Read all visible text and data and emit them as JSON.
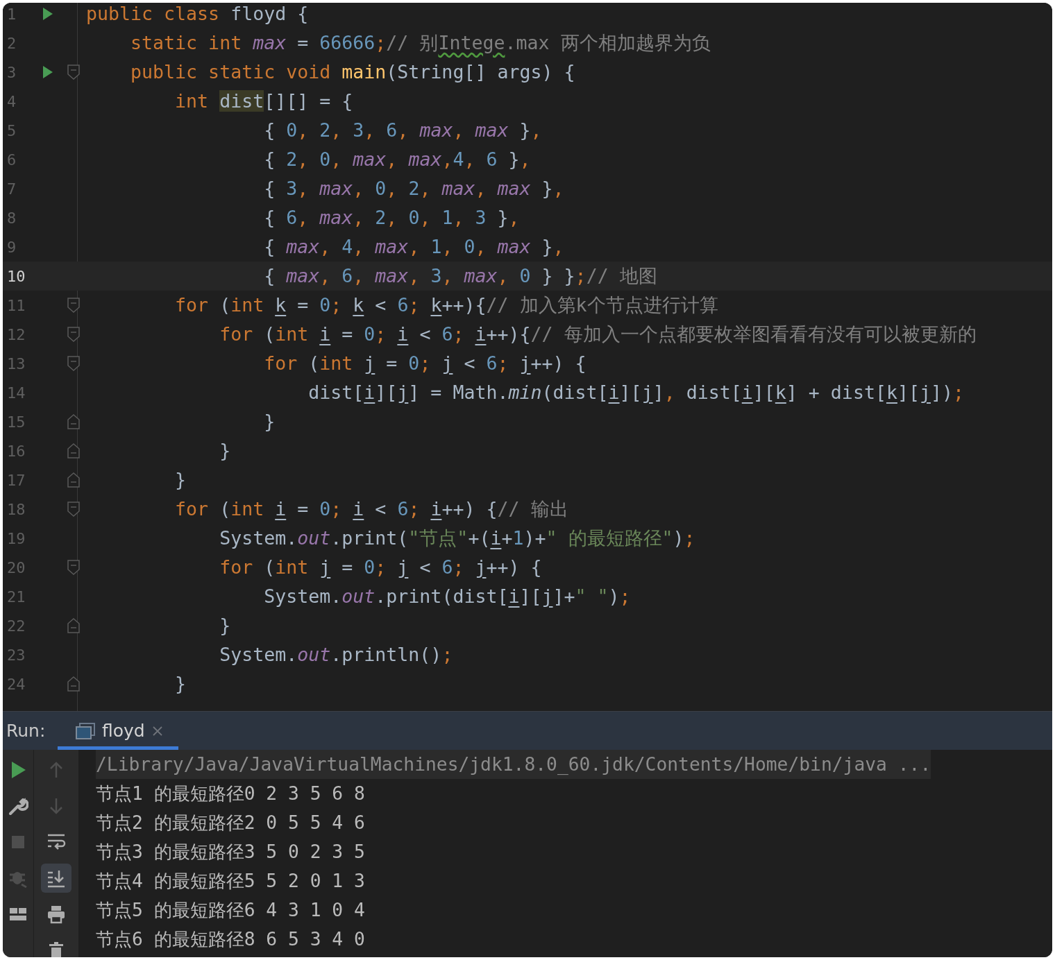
{
  "editor": {
    "lines": [
      {
        "number": "1",
        "run": true,
        "tokens": [
          {
            "kind": "kw",
            "text": "public class "
          },
          {
            "kind": "plain",
            "text": "floyd {"
          }
        ]
      },
      {
        "number": "2",
        "tokens": [
          {
            "kind": "kw",
            "text": "    static int "
          },
          {
            "kind": "field",
            "text": "max"
          },
          {
            "kind": "plain",
            "text": " = "
          },
          {
            "kind": "num",
            "text": "66666"
          },
          {
            "kind": "kw",
            "text": ";"
          },
          {
            "kind": "cmt",
            "text": "// 别"
          },
          {
            "kind": "typo",
            "text": "Intege"
          },
          {
            "kind": "cmt",
            "text": ".max 两个相加越界为负"
          }
        ]
      },
      {
        "number": "3",
        "run": true,
        "fold_open": true,
        "tokens": [
          {
            "kind": "kw",
            "text": "    public static void "
          },
          {
            "kind": "method",
            "text": "main"
          },
          {
            "kind": "plain",
            "text": "(String[] args) {"
          }
        ]
      },
      {
        "number": "4",
        "tokens": [
          {
            "kind": "kw",
            "text": "        int "
          },
          {
            "kind": "hl",
            "text": "dist"
          },
          {
            "kind": "plain",
            "text": "[][] = {"
          }
        ]
      },
      {
        "number": "5",
        "tokens": [
          {
            "kind": "plain",
            "text": "                { "
          },
          {
            "kind": "num",
            "text": "0"
          },
          {
            "kind": "kw",
            "text": ", "
          },
          {
            "kind": "num",
            "text": "2"
          },
          {
            "kind": "kw",
            "text": ", "
          },
          {
            "kind": "num",
            "text": "3"
          },
          {
            "kind": "kw",
            "text": ", "
          },
          {
            "kind": "num",
            "text": "6"
          },
          {
            "kind": "kw",
            "text": ", "
          },
          {
            "kind": "field",
            "text": "max"
          },
          {
            "kind": "kw",
            "text": ", "
          },
          {
            "kind": "field",
            "text": "max"
          },
          {
            "kind": "plain",
            "text": " }"
          },
          {
            "kind": "kw",
            "text": ","
          }
        ]
      },
      {
        "number": "6",
        "tokens": [
          {
            "kind": "plain",
            "text": "                { "
          },
          {
            "kind": "num",
            "text": "2"
          },
          {
            "kind": "kw",
            "text": ", "
          },
          {
            "kind": "num",
            "text": "0"
          },
          {
            "kind": "kw",
            "text": ", "
          },
          {
            "kind": "field",
            "text": "max"
          },
          {
            "kind": "kw",
            "text": ", "
          },
          {
            "kind": "field",
            "text": "max"
          },
          {
            "kind": "kw",
            "text": ","
          },
          {
            "kind": "num",
            "text": "4"
          },
          {
            "kind": "kw",
            "text": ", "
          },
          {
            "kind": "num",
            "text": "6"
          },
          {
            "kind": "plain",
            "text": " }"
          },
          {
            "kind": "kw",
            "text": ","
          }
        ]
      },
      {
        "number": "7",
        "tokens": [
          {
            "kind": "plain",
            "text": "                { "
          },
          {
            "kind": "num",
            "text": "3"
          },
          {
            "kind": "kw",
            "text": ", "
          },
          {
            "kind": "field",
            "text": "max"
          },
          {
            "kind": "kw",
            "text": ", "
          },
          {
            "kind": "num",
            "text": "0"
          },
          {
            "kind": "kw",
            "text": ", "
          },
          {
            "kind": "num",
            "text": "2"
          },
          {
            "kind": "kw",
            "text": ", "
          },
          {
            "kind": "field",
            "text": "max"
          },
          {
            "kind": "kw",
            "text": ", "
          },
          {
            "kind": "field",
            "text": "max"
          },
          {
            "kind": "plain",
            "text": " }"
          },
          {
            "kind": "kw",
            "text": ","
          }
        ]
      },
      {
        "number": "8",
        "tokens": [
          {
            "kind": "plain",
            "text": "                { "
          },
          {
            "kind": "num",
            "text": "6"
          },
          {
            "kind": "kw",
            "text": ", "
          },
          {
            "kind": "field",
            "text": "max"
          },
          {
            "kind": "kw",
            "text": ", "
          },
          {
            "kind": "num",
            "text": "2"
          },
          {
            "kind": "kw",
            "text": ", "
          },
          {
            "kind": "num",
            "text": "0"
          },
          {
            "kind": "kw",
            "text": ", "
          },
          {
            "kind": "num",
            "text": "1"
          },
          {
            "kind": "kw",
            "text": ", "
          },
          {
            "kind": "num",
            "text": "3"
          },
          {
            "kind": "plain",
            "text": " }"
          },
          {
            "kind": "kw",
            "text": ","
          }
        ]
      },
      {
        "number": "9",
        "tokens": [
          {
            "kind": "plain",
            "text": "                { "
          },
          {
            "kind": "field",
            "text": "max"
          },
          {
            "kind": "kw",
            "text": ", "
          },
          {
            "kind": "num",
            "text": "4"
          },
          {
            "kind": "kw",
            "text": ", "
          },
          {
            "kind": "field",
            "text": "max"
          },
          {
            "kind": "kw",
            "text": ", "
          },
          {
            "kind": "num",
            "text": "1"
          },
          {
            "kind": "kw",
            "text": ", "
          },
          {
            "kind": "num",
            "text": "0"
          },
          {
            "kind": "kw",
            "text": ", "
          },
          {
            "kind": "field",
            "text": "max"
          },
          {
            "kind": "plain",
            "text": " }"
          },
          {
            "kind": "kw",
            "text": ","
          }
        ]
      },
      {
        "number": "10",
        "current": true,
        "tokens": [
          {
            "kind": "plain",
            "text": "                { "
          },
          {
            "kind": "field",
            "text": "max"
          },
          {
            "kind": "kw",
            "text": ", "
          },
          {
            "kind": "num",
            "text": "6"
          },
          {
            "kind": "kw",
            "text": ", "
          },
          {
            "kind": "field",
            "text": "max"
          },
          {
            "kind": "kw",
            "text": ", "
          },
          {
            "kind": "num",
            "text": "3"
          },
          {
            "kind": "kw",
            "text": ", "
          },
          {
            "kind": "field",
            "text": "max"
          },
          {
            "kind": "kw",
            "text": ", "
          },
          {
            "kind": "num",
            "text": "0"
          },
          {
            "kind": "plain",
            "text": " } }"
          },
          {
            "kind": "kw",
            "text": ";"
          },
          {
            "kind": "cmt",
            "text": "// 地图"
          }
        ]
      },
      {
        "number": "11",
        "fold_open": true,
        "tokens": [
          {
            "kind": "kw",
            "text": "        for "
          },
          {
            "kind": "plain",
            "text": "("
          },
          {
            "kind": "kw",
            "text": "int "
          },
          {
            "kind": "var",
            "text": "k"
          },
          {
            "kind": "plain",
            "text": " = "
          },
          {
            "kind": "num",
            "text": "0"
          },
          {
            "kind": "kw",
            "text": "; "
          },
          {
            "kind": "var",
            "text": "k"
          },
          {
            "kind": "plain",
            "text": " < "
          },
          {
            "kind": "num",
            "text": "6"
          },
          {
            "kind": "kw",
            "text": "; "
          },
          {
            "kind": "var",
            "text": "k"
          },
          {
            "kind": "plain",
            "text": "++){"
          },
          {
            "kind": "cmt",
            "text": "// 加入第k个节点进行计算"
          }
        ]
      },
      {
        "number": "12",
        "fold_open": true,
        "tokens": [
          {
            "kind": "kw",
            "text": "            for "
          },
          {
            "kind": "plain",
            "text": "("
          },
          {
            "kind": "kw",
            "text": "int "
          },
          {
            "kind": "var",
            "text": "i"
          },
          {
            "kind": "plain",
            "text": " = "
          },
          {
            "kind": "num",
            "text": "0"
          },
          {
            "kind": "kw",
            "text": "; "
          },
          {
            "kind": "var",
            "text": "i"
          },
          {
            "kind": "plain",
            "text": " < "
          },
          {
            "kind": "num",
            "text": "6"
          },
          {
            "kind": "kw",
            "text": "; "
          },
          {
            "kind": "var",
            "text": "i"
          },
          {
            "kind": "plain",
            "text": "++){"
          },
          {
            "kind": "cmt",
            "text": "// 每加入一个点都要枚举图看看有没有可以被更新的"
          }
        ]
      },
      {
        "number": "13",
        "fold_open": true,
        "tokens": [
          {
            "kind": "kw",
            "text": "                for "
          },
          {
            "kind": "plain",
            "text": "("
          },
          {
            "kind": "kw",
            "text": "int "
          },
          {
            "kind": "var",
            "text": "j"
          },
          {
            "kind": "plain",
            "text": " = "
          },
          {
            "kind": "num",
            "text": "0"
          },
          {
            "kind": "kw",
            "text": "; "
          },
          {
            "kind": "var",
            "text": "j"
          },
          {
            "kind": "plain",
            "text": " < "
          },
          {
            "kind": "num",
            "text": "6"
          },
          {
            "kind": "kw",
            "text": "; "
          },
          {
            "kind": "var",
            "text": "j"
          },
          {
            "kind": "plain",
            "text": "++) {"
          }
        ]
      },
      {
        "number": "14",
        "tokens": [
          {
            "kind": "plain",
            "text": "                    dist["
          },
          {
            "kind": "var",
            "text": "i"
          },
          {
            "kind": "plain",
            "text": "]["
          },
          {
            "kind": "var",
            "text": "j"
          },
          {
            "kind": "plain",
            "text": "] = Math."
          },
          {
            "kind": "static",
            "text": "min"
          },
          {
            "kind": "plain",
            "text": "(dist["
          },
          {
            "kind": "var",
            "text": "i"
          },
          {
            "kind": "plain",
            "text": "]["
          },
          {
            "kind": "var",
            "text": "j"
          },
          {
            "kind": "plain",
            "text": "]"
          },
          {
            "kind": "kw",
            "text": ", "
          },
          {
            "kind": "plain",
            "text": "dist["
          },
          {
            "kind": "var",
            "text": "i"
          },
          {
            "kind": "plain",
            "text": "]["
          },
          {
            "kind": "var",
            "text": "k"
          },
          {
            "kind": "plain",
            "text": "] + dist["
          },
          {
            "kind": "var",
            "text": "k"
          },
          {
            "kind": "plain",
            "text": "]["
          },
          {
            "kind": "var",
            "text": "j"
          },
          {
            "kind": "plain",
            "text": "])"
          },
          {
            "kind": "kw",
            "text": ";"
          }
        ]
      },
      {
        "number": "15",
        "fold_close": true,
        "tokens": [
          {
            "kind": "plain",
            "text": "                }"
          }
        ]
      },
      {
        "number": "16",
        "fold_close": true,
        "tokens": [
          {
            "kind": "plain",
            "text": "            }"
          }
        ]
      },
      {
        "number": "17",
        "fold_close": true,
        "tokens": [
          {
            "kind": "plain",
            "text": "        }"
          }
        ]
      },
      {
        "number": "18",
        "fold_open": true,
        "tokens": [
          {
            "kind": "kw",
            "text": "        for "
          },
          {
            "kind": "plain",
            "text": "("
          },
          {
            "kind": "kw",
            "text": "int "
          },
          {
            "kind": "var",
            "text": "i"
          },
          {
            "kind": "plain",
            "text": " = "
          },
          {
            "kind": "num",
            "text": "0"
          },
          {
            "kind": "kw",
            "text": "; "
          },
          {
            "kind": "var",
            "text": "i"
          },
          {
            "kind": "plain",
            "text": " < "
          },
          {
            "kind": "num",
            "text": "6"
          },
          {
            "kind": "kw",
            "text": "; "
          },
          {
            "kind": "var",
            "text": "i"
          },
          {
            "kind": "plain",
            "text": "++) {"
          },
          {
            "kind": "cmt",
            "text": "// 输出"
          }
        ]
      },
      {
        "number": "19",
        "tokens": [
          {
            "kind": "plain",
            "text": "            System."
          },
          {
            "kind": "field",
            "text": "out"
          },
          {
            "kind": "plain",
            "text": ".print("
          },
          {
            "kind": "str",
            "text": "\"节点\""
          },
          {
            "kind": "plain",
            "text": "+("
          },
          {
            "kind": "var",
            "text": "i"
          },
          {
            "kind": "plain",
            "text": "+"
          },
          {
            "kind": "num",
            "text": "1"
          },
          {
            "kind": "plain",
            "text": ")+"
          },
          {
            "kind": "str",
            "text": "\" 的最短路径\""
          },
          {
            "kind": "plain",
            "text": ")"
          },
          {
            "kind": "kw",
            "text": ";"
          }
        ]
      },
      {
        "number": "20",
        "fold_open": true,
        "tokens": [
          {
            "kind": "kw",
            "text": "            for "
          },
          {
            "kind": "plain",
            "text": "("
          },
          {
            "kind": "kw",
            "text": "int "
          },
          {
            "kind": "var",
            "text": "j"
          },
          {
            "kind": "plain",
            "text": " = "
          },
          {
            "kind": "num",
            "text": "0"
          },
          {
            "kind": "kw",
            "text": "; "
          },
          {
            "kind": "var",
            "text": "j"
          },
          {
            "kind": "plain",
            "text": " < "
          },
          {
            "kind": "num",
            "text": "6"
          },
          {
            "kind": "kw",
            "text": "; "
          },
          {
            "kind": "var",
            "text": "j"
          },
          {
            "kind": "plain",
            "text": "++) {"
          }
        ]
      },
      {
        "number": "21",
        "tokens": [
          {
            "kind": "plain",
            "text": "                System."
          },
          {
            "kind": "field",
            "text": "out"
          },
          {
            "kind": "plain",
            "text": ".print(dist["
          },
          {
            "kind": "var",
            "text": "i"
          },
          {
            "kind": "plain",
            "text": "]["
          },
          {
            "kind": "var",
            "text": "j"
          },
          {
            "kind": "plain",
            "text": "]+"
          },
          {
            "kind": "str",
            "text": "\" \""
          },
          {
            "kind": "plain",
            "text": ")"
          },
          {
            "kind": "kw",
            "text": ";"
          }
        ]
      },
      {
        "number": "22",
        "fold_close": true,
        "tokens": [
          {
            "kind": "plain",
            "text": "            }"
          }
        ]
      },
      {
        "number": "23",
        "tokens": [
          {
            "kind": "plain",
            "text": "            System."
          },
          {
            "kind": "field",
            "text": "out"
          },
          {
            "kind": "plain",
            "text": ".println()"
          },
          {
            "kind": "kw",
            "text": ";"
          }
        ]
      },
      {
        "number": "24",
        "fold_close": true,
        "tokens": [
          {
            "kind": "plain",
            "text": "        }"
          }
        ]
      }
    ]
  },
  "run_panel": {
    "label": "Run:",
    "tabs": [
      {
        "label": "floyd",
        "selected": true
      }
    ],
    "toolbar_left": [
      {
        "kind": "rerun",
        "disabled": false
      },
      {
        "kind": "wrench",
        "disabled": false
      },
      {
        "kind": "stop",
        "disabled": true
      },
      {
        "kind": "bug",
        "disabled": true
      },
      {
        "kind": "layout",
        "disabled": false
      }
    ],
    "toolbar_right": [
      {
        "kind": "up",
        "disabled": true
      },
      {
        "kind": "down",
        "disabled": true
      },
      {
        "kind": "wrap",
        "disabled": false,
        "selected": false
      },
      {
        "kind": "scroll-end",
        "disabled": false,
        "selected": true
      },
      {
        "kind": "print",
        "disabled": false
      },
      {
        "kind": "trash",
        "disabled": false
      }
    ],
    "console": [
      {
        "kind": "command",
        "text": "/Library/Java/JavaVirtualMachines/jdk1.8.0_60.jdk/Contents/Home/bin/java ..."
      },
      {
        "kind": "output",
        "text": "节点1 的最短路径0 2 3 5 6 8"
      },
      {
        "kind": "output",
        "text": "节点2 的最短路径2 0 5 5 4 6"
      },
      {
        "kind": "output",
        "text": "节点3 的最短路径3 5 0 2 3 5"
      },
      {
        "kind": "output",
        "text": "节点4 的最短路径5 5 2 0 1 3"
      },
      {
        "kind": "output",
        "text": "节点5 的最短路径6 4 3 1 0 4"
      },
      {
        "kind": "output",
        "text": "节点6 的最短路径8 6 5 3 4 0"
      }
    ]
  }
}
